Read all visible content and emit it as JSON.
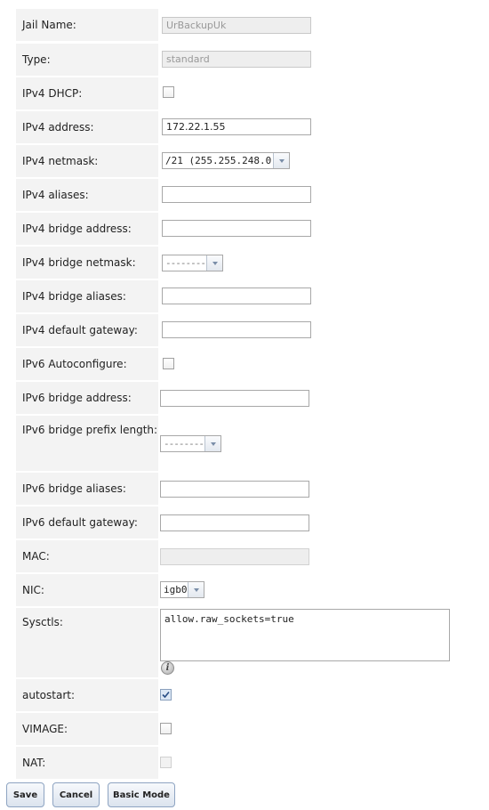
{
  "fields": {
    "jail_name": {
      "label": "Jail Name:",
      "value": "UrBackupUk"
    },
    "type": {
      "label": "Type:",
      "value": "standard"
    },
    "ipv4_dhcp": {
      "label": "IPv4 DHCP:",
      "checked": false
    },
    "ipv4_address": {
      "label": "IPv4 address:",
      "value": "172.22.1.55"
    },
    "ipv4_netmask": {
      "label": "IPv4 netmask:",
      "value": "/21 (255.255.248.0)"
    },
    "ipv4_aliases": {
      "label": "IPv4 aliases:",
      "value": ""
    },
    "ipv4_bridge_address": {
      "label": "IPv4 bridge address:",
      "value": ""
    },
    "ipv4_bridge_netmask": {
      "label": "IPv4 bridge netmask:",
      "value": "---------"
    },
    "ipv4_bridge_aliases": {
      "label": "IPv4 bridge aliases:",
      "value": ""
    },
    "ipv4_default_gateway": {
      "label": "IPv4 default gateway:",
      "value": ""
    },
    "ipv6_autoconfigure": {
      "label": "IPv6 Autoconfigure:",
      "checked": false
    },
    "ipv6_bridge_address": {
      "label": "IPv6 bridge address:",
      "value": ""
    },
    "ipv6_bridge_prefix_length": {
      "label": "IPv6 bridge prefix length:",
      "value": "---------"
    },
    "ipv6_bridge_aliases": {
      "label": "IPv6 bridge aliases:",
      "value": ""
    },
    "ipv6_default_gateway": {
      "label": "IPv6 default gateway:",
      "value": ""
    },
    "mac": {
      "label": "MAC:",
      "value": ""
    },
    "nic": {
      "label": "NIC:",
      "value": "igb0"
    },
    "sysctls": {
      "label": "Sysctls:",
      "value": "allow.raw_sockets=true",
      "help_icon": "info-icon"
    },
    "autostart": {
      "label": "autostart:",
      "checked": true
    },
    "vimage": {
      "label": "VIMAGE:",
      "checked": false
    },
    "nat": {
      "label": "NAT:",
      "checked": false,
      "disabled": true
    }
  },
  "buttons": {
    "save": "Save",
    "cancel": "Cancel",
    "basic_mode": "Basic Mode"
  },
  "colors": {
    "label_bg": "#f3f3f3",
    "button_border": "#8ea4c2",
    "checkbox_checked": "#dde8f5"
  }
}
